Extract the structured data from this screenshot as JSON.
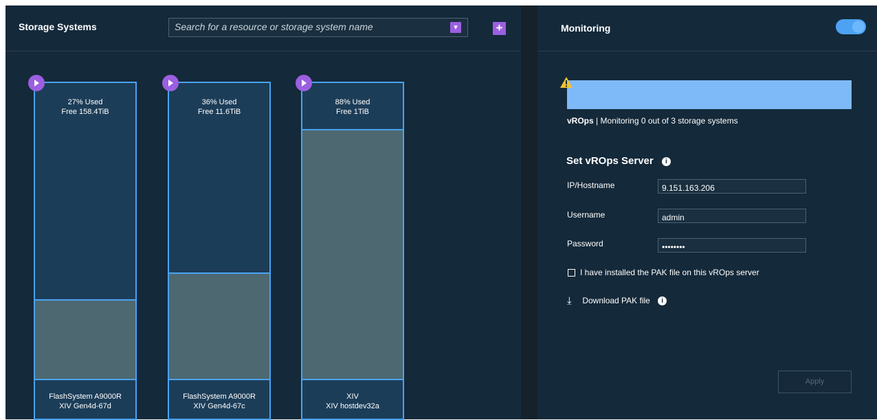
{
  "left": {
    "title": "Storage Systems",
    "search_placeholder": "Search for a resource or storage system name",
    "search_dropdown_icon": "chevron-down-icon",
    "add_label": "+",
    "systems": [
      {
        "used_label": "27% Used",
        "free_label": "Free 158.4TiB",
        "used_percent": 27,
        "name": "FlashSystem A9000R",
        "host": "XIV Gen4d-67d"
      },
      {
        "used_label": "36% Used",
        "free_label": "Free 11.6TiB",
        "used_percent": 36,
        "name": "FlashSystem A9000R",
        "host": "XIV Gen4d-67c"
      },
      {
        "used_label": "88% Used",
        "free_label": "Free 1TiB",
        "used_percent": 88,
        "name": "XIV",
        "host": "XIV hostdev32a"
      }
    ]
  },
  "right": {
    "title": "Monitoring",
    "toggle_state": "on",
    "alert": {
      "icon": "warning-icon",
      "bar_color": "#7fbaf8"
    },
    "vrops_label": "vROps",
    "vrops_status": "Monitoring 0 out of 3 storage systems",
    "set_server_title": "Set vROps Server",
    "form": {
      "ip_label": "IP/Hostname",
      "ip_value": "9.151.163.206",
      "username_label": "Username",
      "username_value": "admin",
      "password_label": "Password",
      "password_value": "••••••••"
    },
    "pak_checkbox_label": "I have installed the PAK file on this vROps server",
    "download_label": "Download PAK file",
    "apply_label": "Apply"
  },
  "colors": {
    "panel_bg": "#14293a",
    "accent_purple": "#9b5fe0",
    "accent_blue": "#4aa3f2",
    "used_fill": "#4d6870"
  }
}
